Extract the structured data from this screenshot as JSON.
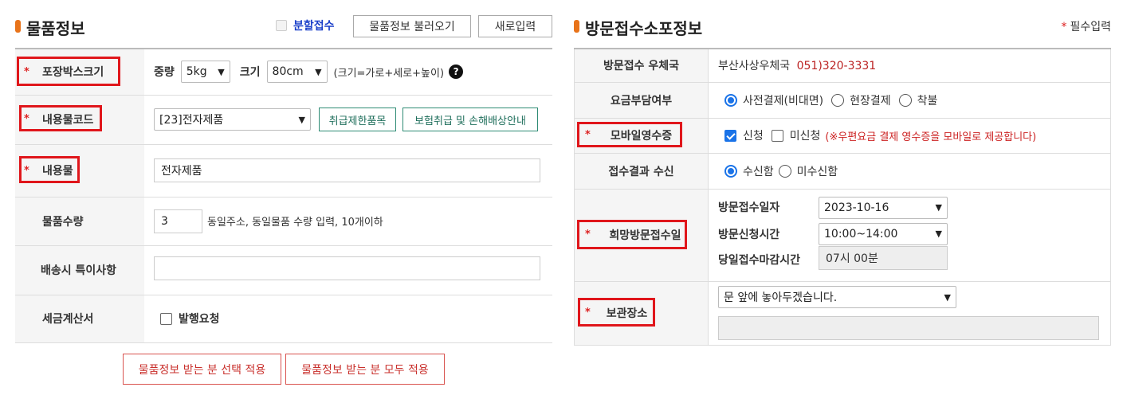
{
  "left": {
    "title": "물품정보",
    "split_label": "분할접수",
    "load_button": "물품정보 불러오기",
    "new_button": "새로입력",
    "rows": {
      "box_size": {
        "label": "포장박스크기",
        "weight_label": "중량",
        "weight_value": "5kg",
        "size_label": "크기",
        "size_value": "80cm",
        "hint": "(크기=가로+세로+높이)",
        "help": "?"
      },
      "content_code": {
        "label": "내용물코드",
        "value": "[23]전자제품",
        "btn1": "취급제한품목",
        "btn2": "보험취급 및 손해배상안내"
      },
      "content": {
        "label": "내용물",
        "value": "전자제품"
      },
      "quantity": {
        "label": "물품수량",
        "value": "3",
        "hint": "동일주소, 동일물품 수량 입력, 10개이하"
      },
      "special": {
        "label": "배송시 특이사항",
        "value": ""
      },
      "tax": {
        "label": "세금계산서",
        "checkbox_label": "발행요청"
      }
    },
    "apply_selected": "물품정보 받는 분 선택 적용",
    "apply_all": "물품정보 받는 분 모두 적용"
  },
  "right": {
    "title": "방문접수소포정보",
    "required_star": "*",
    "required_note": "필수입력",
    "rows": {
      "office": {
        "label": "방문접수 우체국",
        "name": "부산사상우체국",
        "phone": "051)320-3331"
      },
      "fee": {
        "label": "요금부담여부",
        "opt1": "사전결제(비대면)",
        "opt2": "현장결제",
        "opt3": "착불"
      },
      "receipt": {
        "label": "모바일영수증",
        "opt1": "신청",
        "opt2": "미신청",
        "note": "(※우편요금 결제 영수증을 모바일로 제공합니다)"
      },
      "result": {
        "label": "접수결과 수신",
        "opt1": "수신함",
        "opt2": "미수신함"
      },
      "visit": {
        "label": "희망방문접수일",
        "date_label": "방문접수일자",
        "date_value": "2023-10-16",
        "time_label": "방문신청시간",
        "time_value": "10:00~14:00",
        "deadline_label": "당일접수마감시간",
        "deadline_value": "07시 00분"
      },
      "storage": {
        "label": "보관장소",
        "value": "문 앞에 놓아두겠습니다.",
        "extra": ""
      }
    }
  },
  "star": "*",
  "colors": {
    "accent": "#e8731a",
    "required": "#dd2222",
    "highlight_box": "#e0161b",
    "link_blue": "#1a3fc9",
    "teal": "#2e8b74"
  }
}
